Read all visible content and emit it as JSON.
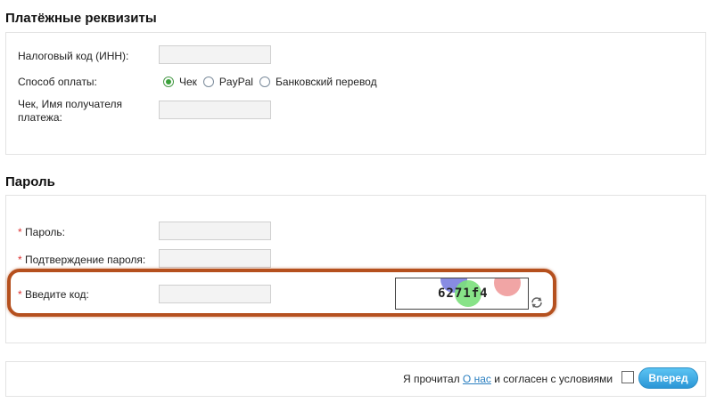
{
  "payment_section": {
    "title": "Платёжные реквизиты",
    "tax_code_label": "Налоговый код (ИНН):",
    "tax_code_value": "",
    "payment_method_label": "Способ оплаты:",
    "payment_options": [
      {
        "label": "Чек",
        "selected": true
      },
      {
        "label": "PayPal",
        "selected": false
      },
      {
        "label": "Банковский перевод",
        "selected": false
      }
    ],
    "payee_label_line1": "Чек, Имя получателя",
    "payee_label_line2": "платежа:",
    "payee_value": ""
  },
  "password_section": {
    "title": "Пароль",
    "required_mark": "*",
    "password_label": "Пароль:",
    "password_value": "",
    "confirm_label": "Подтверждение пароля:",
    "confirm_value": "",
    "code_label": "Введите код:",
    "code_value": "",
    "captcha_text": "6271f4"
  },
  "footer": {
    "agree_prefix": "Я прочитал",
    "agree_link": "О нас",
    "agree_suffix": "и согласен с условиями",
    "agree_checked": false,
    "next_button": "Вперед"
  },
  "colors": {
    "accent": "#2b96d6",
    "link": "#2a7fc0",
    "required": "#dd3333",
    "highlight": "#b5501e"
  }
}
